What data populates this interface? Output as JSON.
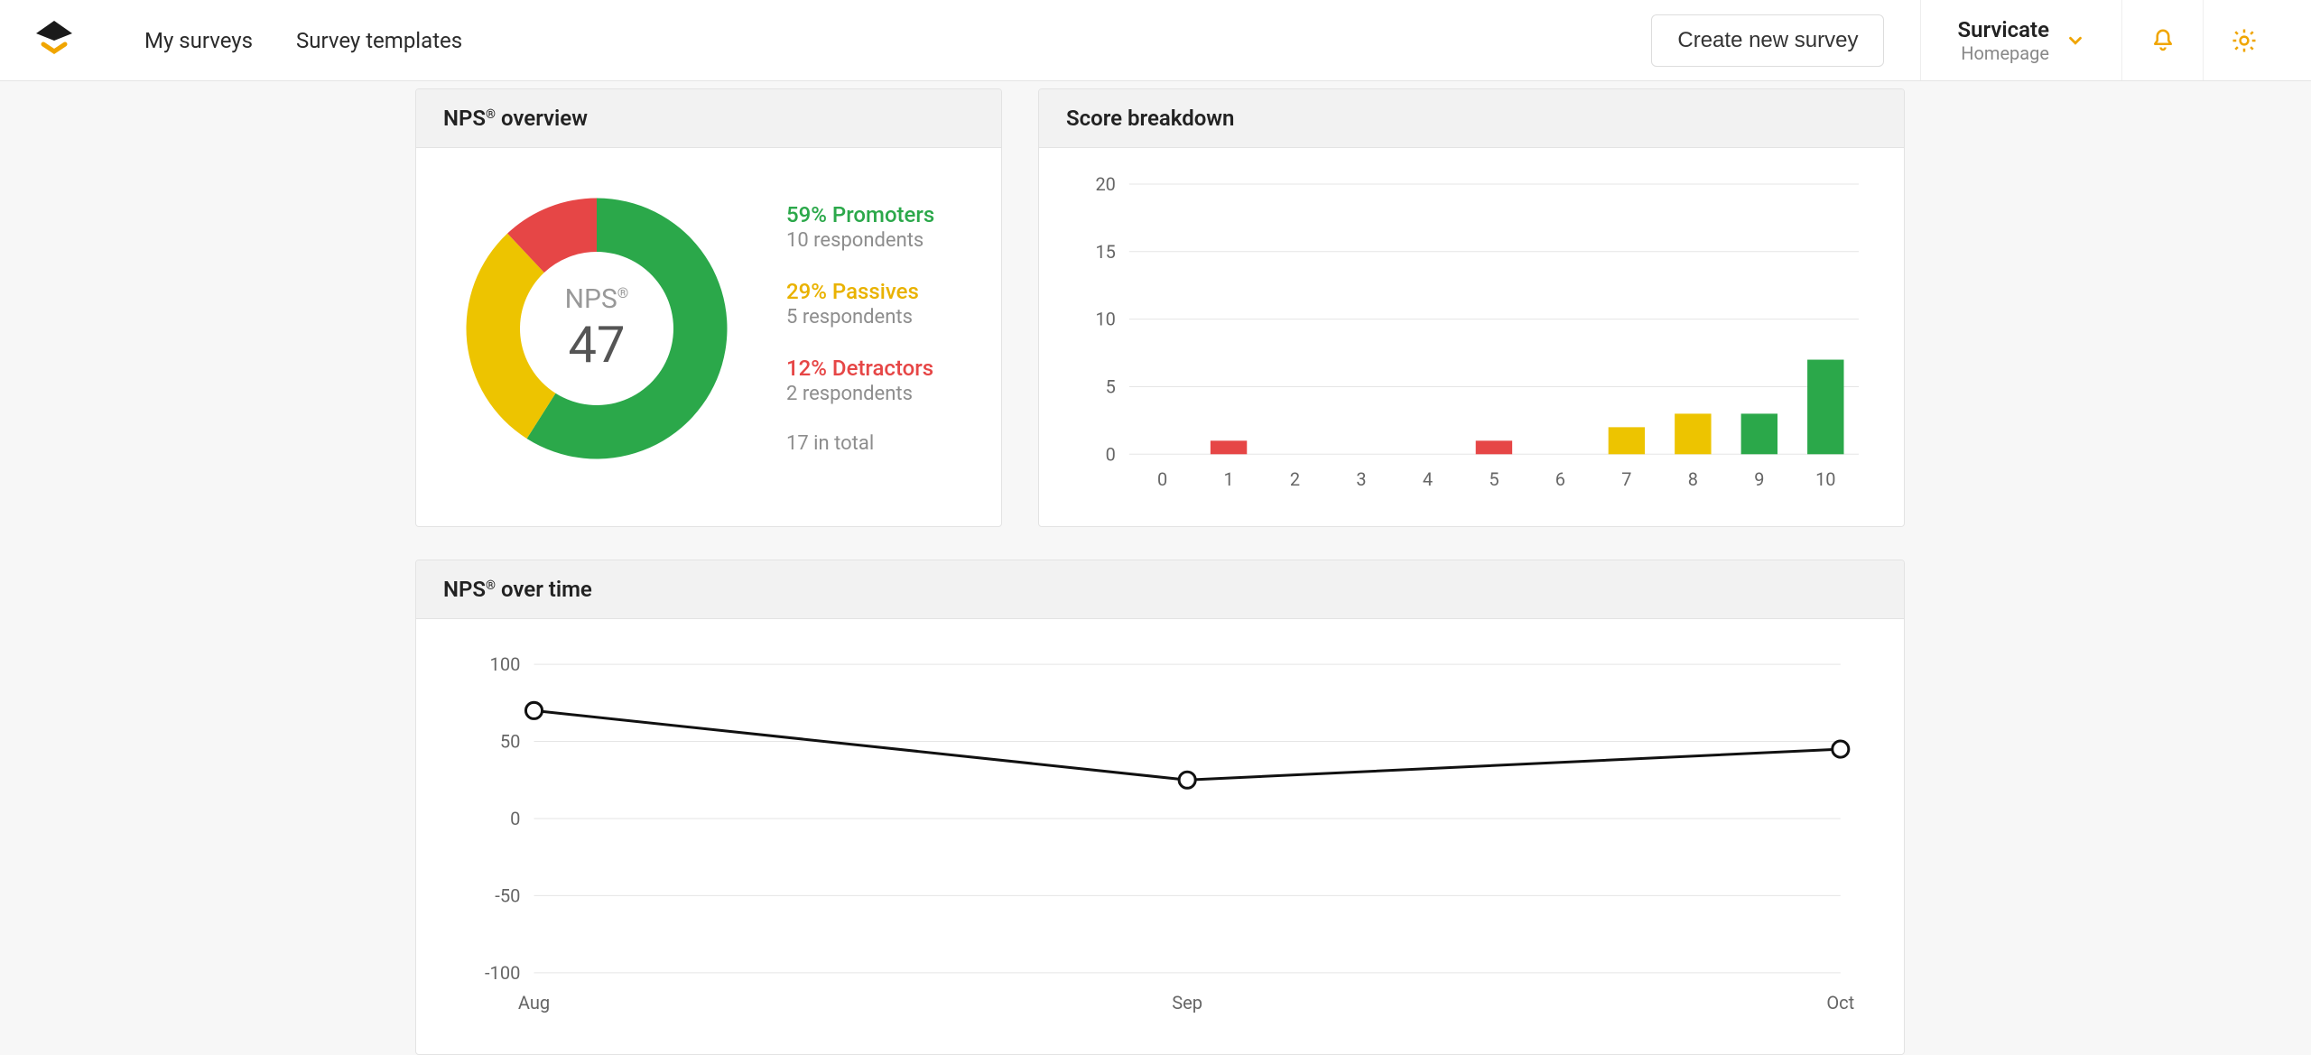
{
  "nav": {
    "my_surveys": "My surveys",
    "templates": "Survey templates",
    "create": "Create new survey"
  },
  "project": {
    "name": "Survicate",
    "sub": "Homepage"
  },
  "overview": {
    "title_prefix": "NPS",
    "title_suffix": " overview",
    "center_label_prefix": "NPS",
    "center_value": "47",
    "promoters": {
      "line1": "59% Promoters",
      "line2": "10 respondents"
    },
    "passives": {
      "line1": "29% Passives",
      "line2": "5 respondents"
    },
    "detractors": {
      "line1": "12% Detractors",
      "line2": "2 respondents"
    },
    "total": "17 in total"
  },
  "breakdown": {
    "title": "Score breakdown"
  },
  "overtime": {
    "title_prefix": "NPS",
    "title_suffix": " over time"
  },
  "colors": {
    "promoter": "#2ba84a",
    "passive": "#edc400",
    "detractor": "#e64646"
  },
  "chart_data": [
    {
      "id": "nps_donut",
      "type": "pie",
      "title": "NPS overview",
      "series": [
        {
          "name": "Promoters",
          "value": 59,
          "respondents": 10,
          "color": "#2ba84a"
        },
        {
          "name": "Passives",
          "value": 29,
          "respondents": 5,
          "color": "#edc400"
        },
        {
          "name": "Detractors",
          "value": 12,
          "respondents": 2,
          "color": "#e64646"
        }
      ],
      "center_value": 47,
      "total_respondents": 17
    },
    {
      "id": "score_breakdown",
      "type": "bar",
      "title": "Score breakdown",
      "categories": [
        "0",
        "1",
        "2",
        "3",
        "4",
        "5",
        "6",
        "7",
        "8",
        "9",
        "10"
      ],
      "values": [
        0,
        1,
        0,
        0,
        0,
        1,
        0,
        2,
        3,
        3,
        7
      ],
      "colors": [
        "#e64646",
        "#e64646",
        "#e64646",
        "#e64646",
        "#e64646",
        "#e64646",
        "#e64646",
        "#edc400",
        "#edc400",
        "#2ba84a",
        "#2ba84a"
      ],
      "ylabel": "",
      "xlabel": "",
      "ylim": [
        0,
        20
      ],
      "yticks": [
        0,
        5,
        10,
        15,
        20
      ]
    },
    {
      "id": "nps_over_time",
      "type": "line",
      "title": "NPS over time",
      "categories": [
        "Aug",
        "Sep",
        "Oct"
      ],
      "values": [
        70,
        25,
        45
      ],
      "ylim": [
        -100,
        100
      ],
      "yticks": [
        -100,
        -50,
        0,
        50,
        100
      ]
    }
  ]
}
